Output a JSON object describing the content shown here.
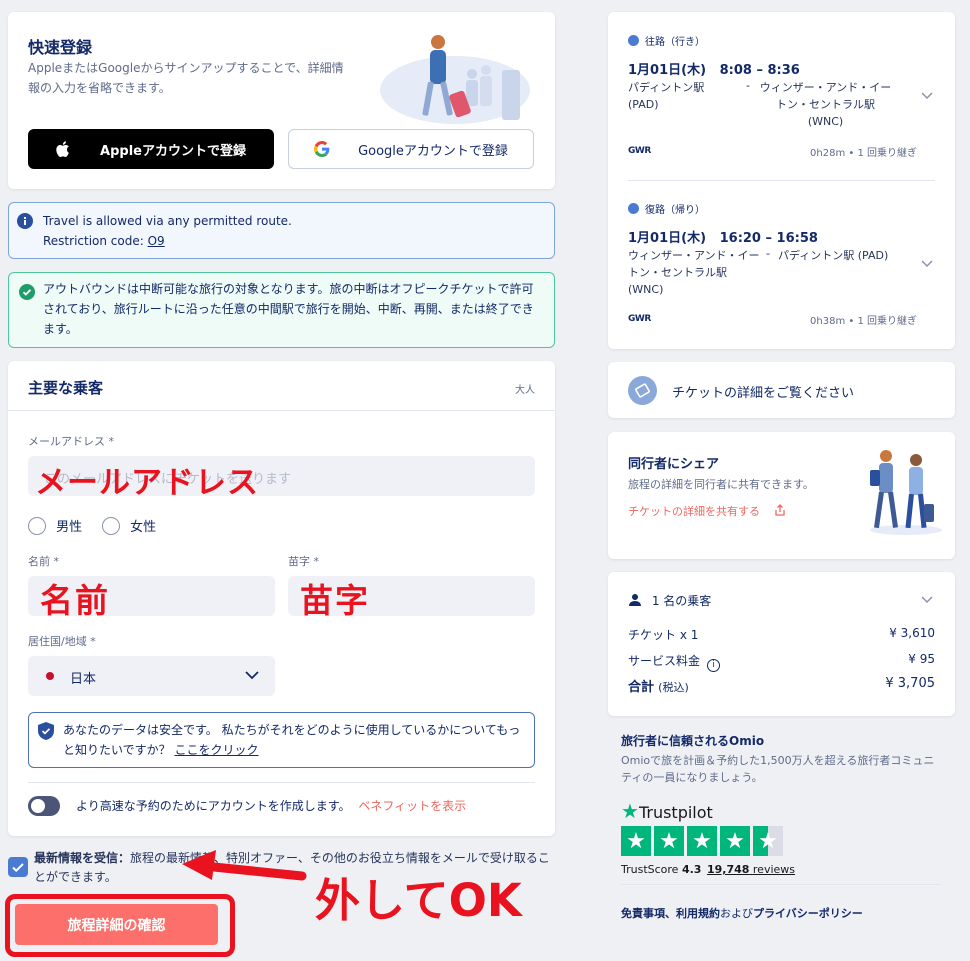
{
  "signup": {
    "title": "快速登録",
    "desc": "AppleまたはGoogleからサインアップすることで、詳細情報の入力を省略できます。",
    "apple_label": "Appleアカウントで登録",
    "google_label": "Googleアカウントで登録"
  },
  "route_info": {
    "line1": "Travel is allowed via any permitted route.",
    "line2_prefix": "Restriction code: ",
    "code": "O9"
  },
  "break_info": "アウトバウンドは中断可能な旅行の対象となります。旅の中断はオフピークチケットで許可されており、旅行ルートに沿った任意の中間駅で旅行を開始、中断、再開、または終了できます。",
  "passenger": {
    "title": "主要な乗客",
    "type": "大人",
    "email_label": "メールアドレス *",
    "email_placeholder": "このメールアドレスにチケットを送ります",
    "male": "男性",
    "female": "女性",
    "first_label": "名前 *",
    "last_label": "苗字 *",
    "country_label": "居住国/地域 *",
    "country_value": "日本",
    "privacy_text": "あなたのデータは安全です。 私たちがそれをどのように使用しているかについてもっと知りたいですか？",
    "privacy_link": "ここをクリック",
    "account_text": "より高速な予約のためにアカウントを作成します。",
    "benefit_link": "ベネフィットを表示"
  },
  "newsletter": {
    "bold": "最新情報を受信：",
    "text": "旅程の最新情報、特別オファー、その他のお役立ち情報をメールで受け取ることができます。"
  },
  "confirm_button": "旅程詳細の確認",
  "annotations": {
    "email": "メールアドレス",
    "first": "名前",
    "last": "苗字",
    "ok": "外してOK"
  },
  "outbound": {
    "heading": "往路（行き）",
    "time": "1月01日(木)   8:08 – 8:36",
    "from": "パディントン駅 (PAD)",
    "dash": "-",
    "to": "ウィンザー・アンド・イートン・セントラル駅 (WNC)",
    "operator": "GWR",
    "meta": "0h28m • 1 回乗り継ぎ"
  },
  "return": {
    "heading": "復路（帰り）",
    "time": "1月01日(木)   16:20 – 16:58",
    "from": "ウィンザー・アンド・イートン・セントラル駅 (WNC)",
    "dash": "-",
    "to": "パディントン駅 (PAD)",
    "operator": "GWR",
    "meta": "0h38m • 1 回乗り継ぎ"
  },
  "ticket_details": "チケットの詳細をご覧ください",
  "share": {
    "title": "同行者にシェア",
    "desc": "旅程の詳細を同行者に共有できます。",
    "link": "チケットの詳細を共有する"
  },
  "price": {
    "passengers": "1 名の乗客",
    "ticket_label": "チケット x 1",
    "ticket_value": "¥ 3,610",
    "service_label": "サービス料金",
    "service_value": "¥ 95",
    "total_label": "合計",
    "total_tax": "(税込)",
    "total_value": "¥ 3,705"
  },
  "trust": {
    "title": "旅行者に信頼されるOmio",
    "desc": "Omioで旅を計画＆予約した1,500万人を超える旅行者コミュニティの一員になりましょう。",
    "brand": "Trustpilot",
    "score_label": "TrustScore",
    "score": "4.3",
    "reviews_count": "19,748",
    "reviews_label": "reviews",
    "stars": 4.3
  },
  "legal": {
    "p1": "免責事項、",
    "p2": "利用規約",
    "p3": "および",
    "p4": "プライバシーポリシー"
  }
}
